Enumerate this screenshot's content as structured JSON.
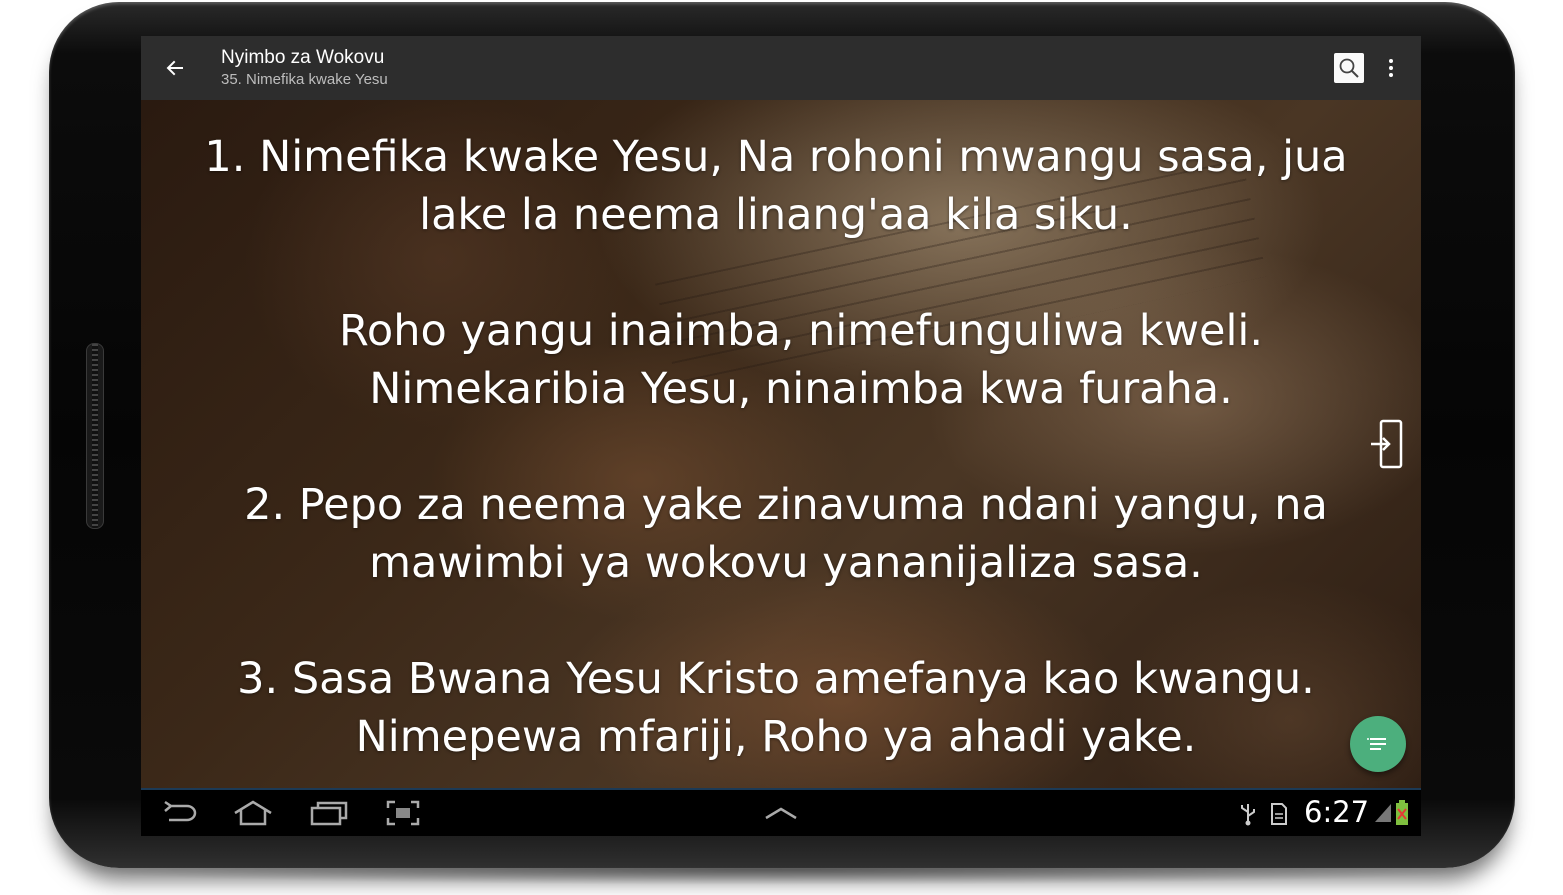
{
  "actionbar": {
    "title": "Nyimbo za Wokovu",
    "subtitle": "35. Nimefika kwake Yesu",
    "icons": [
      "back-arrow-icon",
      "search-icon",
      "overflow-menu-icon"
    ]
  },
  "lyrics": {
    "verses": [
      {
        "line1": "1. Nimefika kwake Yesu, Na rohoni mwangu sasa, jua",
        "line2": "lake la neema linang'aa kila siku."
      },
      {
        "line1": "Roho yangu inaimba, nimefunguliwa kweli.",
        "line2": "Nimekaribia Yesu, ninaimba kwa furaha."
      },
      {
        "line1": "2. Pepo za neema yake zinavuma ndani yangu, na",
        "line2": "mawimbi ya wokovu yananijaliza sasa."
      },
      {
        "line1": "3. Sasa Bwana Yesu Kristo amefanya kao kwangu.",
        "line2": "Nimepewa mfariji, Roho ya ahadi yake."
      }
    ]
  },
  "controls": {
    "side_icon": "exit-to-app-icon",
    "fab_icon": "list-icon",
    "fab_color": "#4caf7d"
  },
  "system_bar": {
    "time": "6:27",
    "nav_icons": [
      "back-icon",
      "home-icon",
      "recent-apps-icon",
      "screenshot-icon",
      "menu-up-icon"
    ],
    "status_icons": [
      "usb-icon",
      "sd-card-icon",
      "signal-icon",
      "battery-icon"
    ]
  }
}
